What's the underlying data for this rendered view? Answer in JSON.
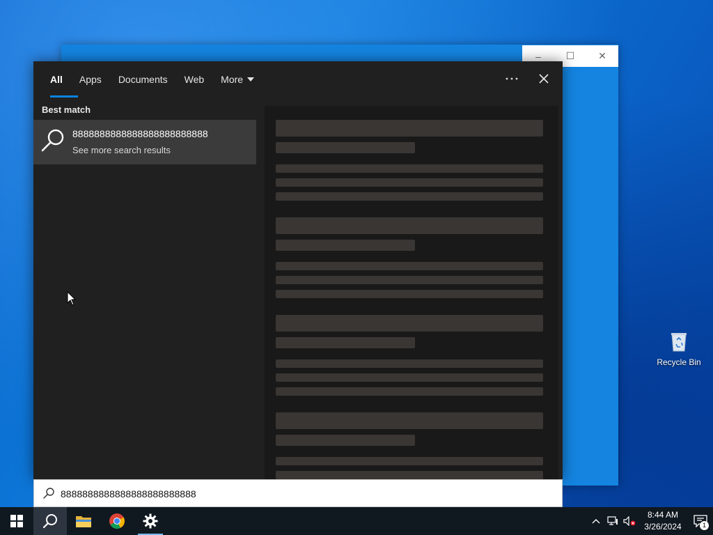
{
  "background_window": {
    "controls": {
      "minimize": "–",
      "maximize": "☐",
      "close": "✕"
    }
  },
  "search_panel": {
    "tabs": [
      {
        "label": "All",
        "active": true
      },
      {
        "label": "Apps",
        "active": false
      },
      {
        "label": "Documents",
        "active": false
      },
      {
        "label": "Web",
        "active": false
      },
      {
        "label": "More",
        "active": false
      }
    ],
    "options_icon": "more-options-icon",
    "close_icon": "close-icon",
    "best_match_title": "Best match",
    "best_match": {
      "icon": "search-icon",
      "title": "8888888888888888888888888",
      "subtitle": "See more search results"
    },
    "preview_loading": true
  },
  "search_box": {
    "icon": "search-icon",
    "value": "8888888888888888888888888"
  },
  "desktop": {
    "icons": [
      {
        "label": "Recycle Bin",
        "icon": "recycle-bin-icon"
      }
    ]
  },
  "taskbar": {
    "apps": [
      {
        "name": "start",
        "icon": "windows-logo-icon"
      },
      {
        "name": "search",
        "icon": "search-icon",
        "active": true
      },
      {
        "name": "file-explorer",
        "icon": "folder-icon"
      },
      {
        "name": "chrome",
        "icon": "chrome-icon"
      },
      {
        "name": "settings",
        "icon": "gear-icon",
        "running": true
      }
    ],
    "tray": {
      "time": "8:44 AM",
      "date": "3/26/2024",
      "notification_count": "1"
    }
  },
  "colors": {
    "accent": "#0a84e0",
    "panel_bg": "#202020",
    "taskbar_bg": "#101820"
  }
}
